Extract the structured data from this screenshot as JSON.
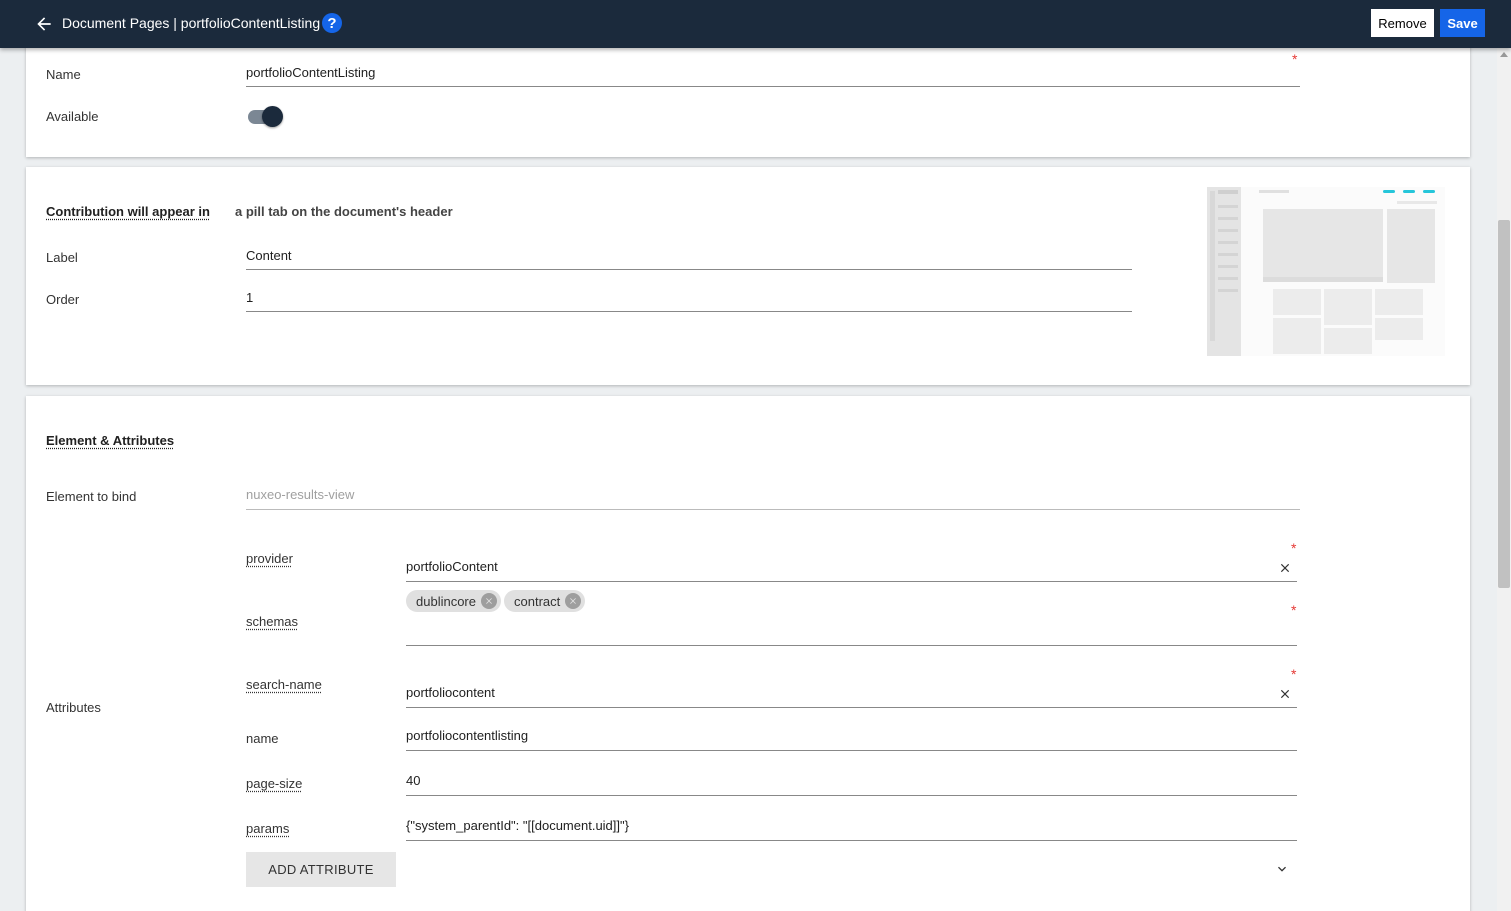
{
  "header": {
    "breadcrumb": "Document Pages | portfolioContentListing",
    "help_icon": "?",
    "remove_label": "Remove",
    "save_label": "Save"
  },
  "general": {
    "name_label": "Name",
    "name_value": "portfolioContentListing",
    "available_label": "Available",
    "available": true
  },
  "contribution": {
    "heading": "Contribution will appear in",
    "description": "a pill tab on the document's header",
    "label_label": "Label",
    "label_value": "Content",
    "order_label": "Order",
    "order_value": "1"
  },
  "element": {
    "heading": "Element & Attributes",
    "bind_label": "Element to bind",
    "bind_placeholder": "nuxeo-results-view",
    "attributes_label": "Attributes",
    "attributes": {
      "provider": {
        "name": "provider",
        "value": "portfolioContent"
      },
      "schemas": {
        "name": "schemas",
        "chips": [
          "dublincore",
          "contract"
        ]
      },
      "search_name": {
        "name": "search-name",
        "value": "portfoliocontent"
      },
      "name": {
        "name": "name",
        "value": "portfoliocontentlisting"
      },
      "page_size": {
        "name": "page-size",
        "value": "40"
      },
      "params": {
        "name": "params",
        "value": "{\"system_parentId\": \"[[document.uid]]\"}"
      }
    },
    "add_attribute_label": "ADD ATTRIBUTE"
  },
  "colors": {
    "header_bg": "#1b2a3c",
    "accent": "#1565e8",
    "required": "#e53935",
    "preview_accent": "#26c6da"
  },
  "icons": [
    "back-arrow-icon",
    "help-icon",
    "close-icon",
    "chip-remove-icon",
    "chevron-down-icon"
  ]
}
